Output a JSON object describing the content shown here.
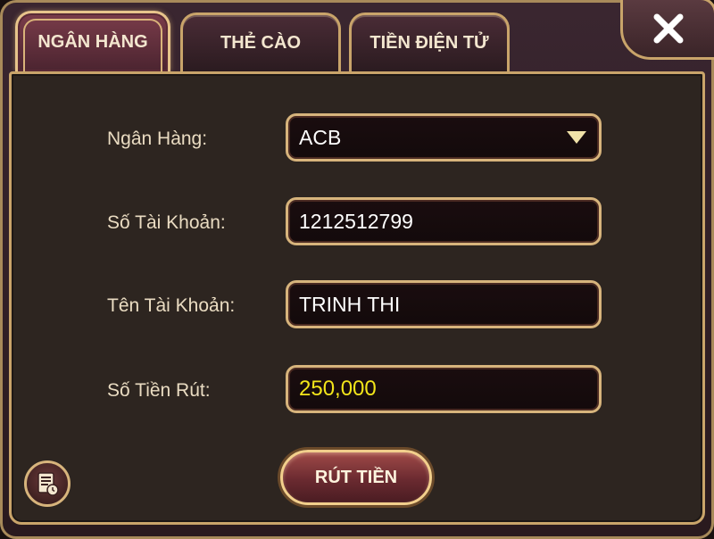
{
  "tabs": [
    {
      "label": "NGÂN HÀNG",
      "active": true
    },
    {
      "label": "THẺ CÀO",
      "active": false
    },
    {
      "label": "TIỀN ĐIỆN TỬ",
      "active": false
    }
  ],
  "form": {
    "bank_label": "Ngân Hàng:",
    "bank_value": "ACB",
    "account_number_label": "Số Tài Khoản:",
    "account_number_value": "1212512799",
    "account_name_label": "Tên Tài Khoản:",
    "account_name_value": "TRINH THI",
    "amount_label": "Số Tiền Rút:",
    "amount_value": "250,000"
  },
  "actions": {
    "withdraw_label": "RÚT TIỀN"
  },
  "icons": {
    "close": "close-icon",
    "dropdown": "chevron-down-icon",
    "history": "history-icon"
  },
  "colors": {
    "accent_gold": "#c9a46a",
    "amount_yellow": "#f2e51a"
  }
}
